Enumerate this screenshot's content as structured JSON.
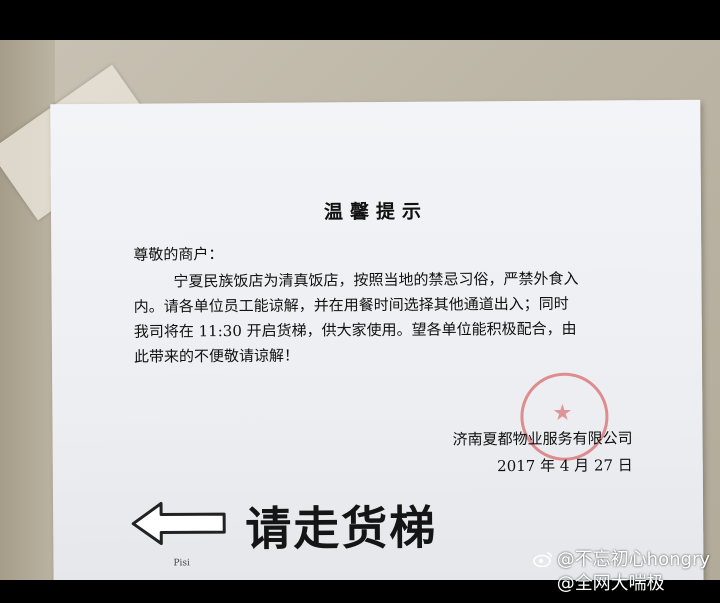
{
  "notice": {
    "title": "温馨提示",
    "greeting": "尊敬的商户：",
    "body_lines": [
      "宁夏民族饭店为清真饭店，按照当地的禁忌习俗，严禁外食入",
      "内。请各单位员工能谅解，并在用餐时间选择其他通道出入；同时",
      "我司将在 11:30 开启货梯，供大家使用。望各单位能积极配合，由",
      "此带来的不便敬请谅解！"
    ],
    "company": "济南夏都物业服务有限公司",
    "date": "2017 年 4 月 27 日",
    "sign_text": "请走货梯",
    "handwritten_mark": "Pisi"
  },
  "watermark": {
    "line1": "@不忘初心hongry",
    "line2": "@全网大喘极"
  },
  "icons": {
    "arrow": "left-arrow-icon",
    "weibo": "weibo-icon"
  }
}
